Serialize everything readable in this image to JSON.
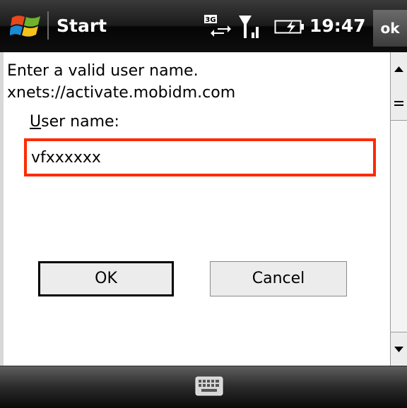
{
  "titlebar": {
    "title": "Start",
    "time": "19:47",
    "ok_label": "ok",
    "network_badge": "3G"
  },
  "dialog": {
    "message": "Enter a valid user name.",
    "url": "xnets://activate.mobidm.com",
    "field_label_accesskey": "U",
    "field_label_rest": "ser name:",
    "username_value": "vfxxxxxx",
    "highlight_color": "#ff2a00"
  },
  "buttons": {
    "ok": "OK",
    "cancel": "Cancel"
  },
  "icons": {
    "start": "windows-flag-icon",
    "network": "3g-data-icon",
    "signal": "signal-strength-icon",
    "battery": "battery-charging-icon",
    "keyboard": "keyboard-icon"
  }
}
